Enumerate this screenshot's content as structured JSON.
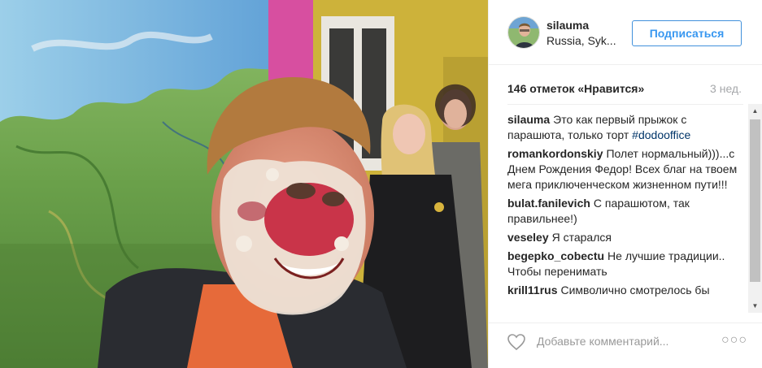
{
  "post": {
    "username": "silauma",
    "location": "Russia, Syk...",
    "follow_label": "Подписаться",
    "likes": "146 отметок «Нравится»",
    "age": "3 нед."
  },
  "comments": [
    {
      "user": "silauma",
      "text": "Это как первый прыжок с парашюта, только торт ",
      "tag": "#dodooffice"
    },
    {
      "user": "romankordonskiy",
      "text": "Полет нормальный)))...с Днем Рождения Федор! Всех благ на твоем мега приключенческом жизненном пути!!!",
      "tag": ""
    },
    {
      "user": "bulat.fanilevich",
      "text": "С парашютом, так правильнее!)",
      "tag": ""
    },
    {
      "user": "veseley",
      "text": "Я старался",
      "tag": ""
    },
    {
      "user": "begepko_cobectu",
      "text": "Не лучшие традиции.. Чтобы перенимать",
      "tag": ""
    },
    {
      "user": "krill11rus",
      "text": "Символично смотрелось бы",
      "tag": ""
    }
  ],
  "footer": {
    "comment_placeholder": "Добавьте комментарий...",
    "more_glyph": "○○○"
  },
  "icons": {
    "heart": "heart-outline-icon",
    "more": "more-options-icon",
    "scroll_up": "scroll-up-arrow",
    "scroll_down": "scroll-down-arrow"
  },
  "colors": {
    "follow_text": "#3897f0",
    "follow_border": "#4090db",
    "hashtag": "#003569",
    "muted": "#999999"
  }
}
